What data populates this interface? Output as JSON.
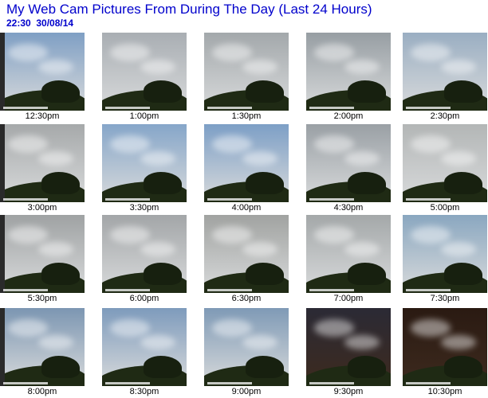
{
  "header": {
    "title": "My Web Cam Pictures From During The Day (Last 24 Hours)",
    "time": "22:30",
    "date": "30/08/14"
  },
  "thumbnails": [
    {
      "label": "12:30pm",
      "sky": "#7f9fc4"
    },
    {
      "label": "1:00pm",
      "sky": "#a9aeb3"
    },
    {
      "label": "1:30pm",
      "sky": "#a3a8ab"
    },
    {
      "label": "2:00pm",
      "sky": "#979ea3"
    },
    {
      "label": "2:30pm",
      "sky": "#9aaec2"
    },
    {
      "label": "3:00pm",
      "sky": "#a6a9aa"
    },
    {
      "label": "3:30pm",
      "sky": "#86a6c9"
    },
    {
      "label": "4:00pm",
      "sky": "#7d9fc6"
    },
    {
      "label": "4:30pm",
      "sky": "#9aa0a5"
    },
    {
      "label": "5:00pm",
      "sky": "#b3b6b6"
    },
    {
      "label": "5:30pm",
      "sky": "#9fa2a3"
    },
    {
      "label": "6:00pm",
      "sky": "#a3a6a8"
    },
    {
      "label": "6:30pm",
      "sky": "#a1a3a1"
    },
    {
      "label": "7:00pm",
      "sky": "#a4a8a9"
    },
    {
      "label": "7:30pm",
      "sky": "#8aa7c0"
    },
    {
      "label": "8:00pm",
      "sky": "#7c96b2"
    },
    {
      "label": "8:30pm",
      "sky": "#7e9bbc"
    },
    {
      "label": "9:00pm",
      "sky": "#7f9ab6"
    },
    {
      "label": "9:30pm",
      "sky": "#2b2a35"
    },
    {
      "label": "10:30pm",
      "sky": "#2a1a12"
    }
  ]
}
